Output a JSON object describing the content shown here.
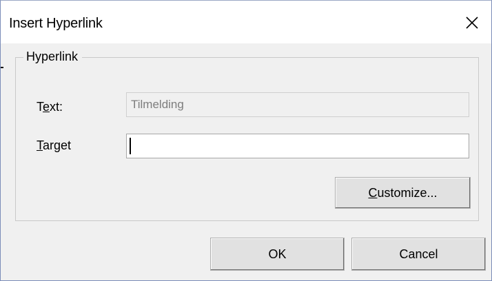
{
  "window": {
    "title": "Insert Hyperlink"
  },
  "group": {
    "legend": "Hyperlink"
  },
  "fields": {
    "text_label_prefix": "T",
    "text_label_underline": "e",
    "text_label_suffix": "xt:",
    "text_value": "Tilmelding",
    "target_label_underline": "T",
    "target_label_suffix": "arget",
    "target_value": ""
  },
  "buttons": {
    "customize_underline": "C",
    "customize_rest": "ustomize...",
    "ok": "OK",
    "cancel": "Cancel"
  },
  "icons": {
    "close": "close-icon"
  },
  "colors": {
    "dialog_bg": "#f0f0f0",
    "titlebar_bg": "#ffffff",
    "button_bg": "#e1e1e1",
    "disabled_text": "#7d7d7d"
  }
}
